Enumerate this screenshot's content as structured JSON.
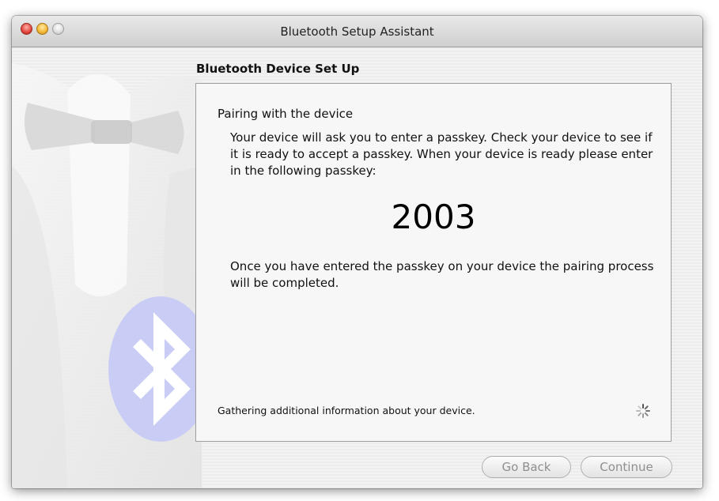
{
  "window": {
    "title": "Bluetooth Setup Assistant"
  },
  "header": {
    "section_title": "Bluetooth Device Set Up"
  },
  "panel": {
    "heading": "Pairing with the device",
    "instructions": "Your device will ask you to enter a passkey. Check your device to see if it is ready to accept a passkey. When your device is ready please enter in the following passkey:",
    "passkey": "2003",
    "completion_text": "Once you have entered the passkey on your device the pairing process will be completed.",
    "status": "Gathering additional information about your device."
  },
  "buttons": {
    "back_label": "Go Back",
    "continue_label": "Continue"
  },
  "icons": {
    "close": "close-icon",
    "minimize": "minimize-icon",
    "zoom": "zoom-icon",
    "spinner": "spinner-icon",
    "bluetooth": "bluetooth-icon"
  },
  "colors": {
    "window_bg": "#ececec",
    "panel_bg": "#f7f7f7",
    "close": "#e0443a",
    "minimize": "#f2b632",
    "bluetooth_badge": "#c7cbf4",
    "disabled_text": "#8f8f8f"
  }
}
